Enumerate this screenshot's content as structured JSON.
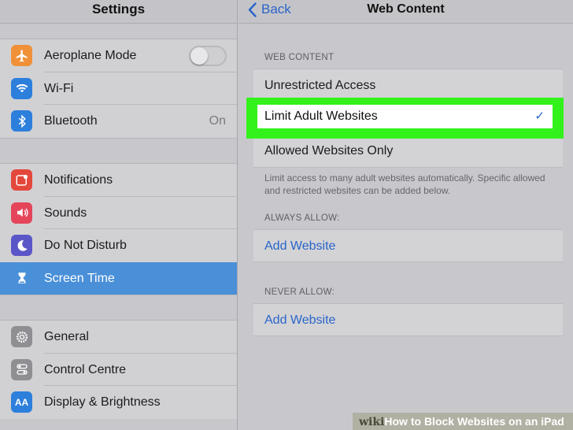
{
  "sidebar": {
    "title": "Settings",
    "groups": [
      {
        "items": [
          {
            "label": "Aeroplane Mode",
            "icon": "airplane-icon",
            "color": "#f0913a",
            "toggle": false
          },
          {
            "label": "Wi-Fi",
            "icon": "wifi-icon",
            "color": "#2d7fdc"
          },
          {
            "label": "Bluetooth",
            "icon": "bluetooth-icon",
            "color": "#2d7fdc",
            "value": "On"
          }
        ]
      },
      {
        "items": [
          {
            "label": "Notifications",
            "icon": "notifications-icon",
            "color": "#e4473b"
          },
          {
            "label": "Sounds",
            "icon": "sounds-icon",
            "color": "#e5455a"
          },
          {
            "label": "Do Not Disturb",
            "icon": "moon-icon",
            "color": "#5a56c8"
          },
          {
            "label": "Screen Time",
            "icon": "hourglass-icon",
            "color": "#5a56c8",
            "selected": true
          }
        ]
      },
      {
        "items": [
          {
            "label": "General",
            "icon": "gear-icon",
            "color": "#8e8e93"
          },
          {
            "label": "Control Centre",
            "icon": "switches-icon",
            "color": "#8e8e93"
          },
          {
            "label": "Display & Brightness",
            "icon": "aa-icon",
            "color": "#2d7fdc"
          }
        ]
      }
    ]
  },
  "detail": {
    "back_label": "Back",
    "title": "Web Content",
    "web_content_header": "WEB CONTENT",
    "options": [
      "Unrestricted Access",
      "Limit Adult Websites",
      "Allowed Websites Only"
    ],
    "selected_option": "Limit Adult Websites",
    "footnote": "Limit access to many adult websites automatically. Specific allowed and restricted websites can be added below.",
    "always_allow_header": "ALWAYS ALLOW:",
    "always_allow_link": "Add Website",
    "never_allow_header": "NEVER ALLOW:",
    "never_allow_link": "Add Website"
  },
  "watermark": {
    "brand": "wiki",
    "text_how": "How",
    "text_rest": " to Block Websites on an iPad"
  },
  "colors": {
    "accent": "#2a64c8",
    "highlight": "#33f21c",
    "selection": "#4a90d9"
  }
}
